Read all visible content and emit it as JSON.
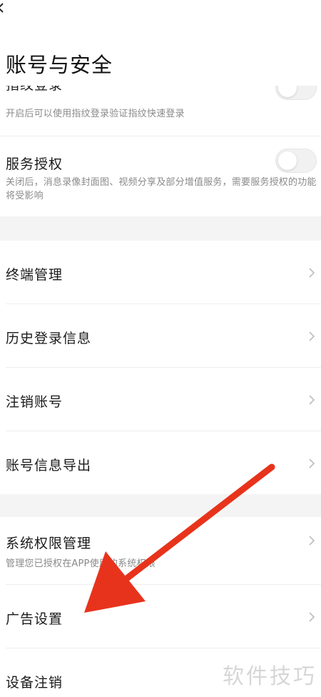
{
  "header": {
    "title": "账号与安全",
    "back_icon": "back-arrow-icon"
  },
  "fingerprint": {
    "label": "指纹登录",
    "desc": "开启后可以使用指纹登录验证指纹快速登录",
    "toggle_on": false
  },
  "service_auth": {
    "label": "服务授权",
    "desc": "关闭后，消息录像封面图、视频分享及部分增值服务，需要服务授权的功能将受影响",
    "toggle_on": false
  },
  "section2": {
    "items": [
      {
        "label": "终端管理"
      },
      {
        "label": "历史登录信息"
      },
      {
        "label": "注销账号"
      },
      {
        "label": "账号信息导出"
      }
    ]
  },
  "section3": {
    "system_permissions": {
      "label": "系统权限管理",
      "desc": "管理您已授权在APP使用的系统权限"
    },
    "ad_settings": {
      "label": "广告设置"
    },
    "device_logout": {
      "label": "设备注销"
    }
  },
  "watermark": "软件技巧",
  "colors": {
    "annotation_arrow": "#e8331c",
    "section_gap": "#f4f4f4",
    "secondary_text": "#8a8a8a"
  }
}
